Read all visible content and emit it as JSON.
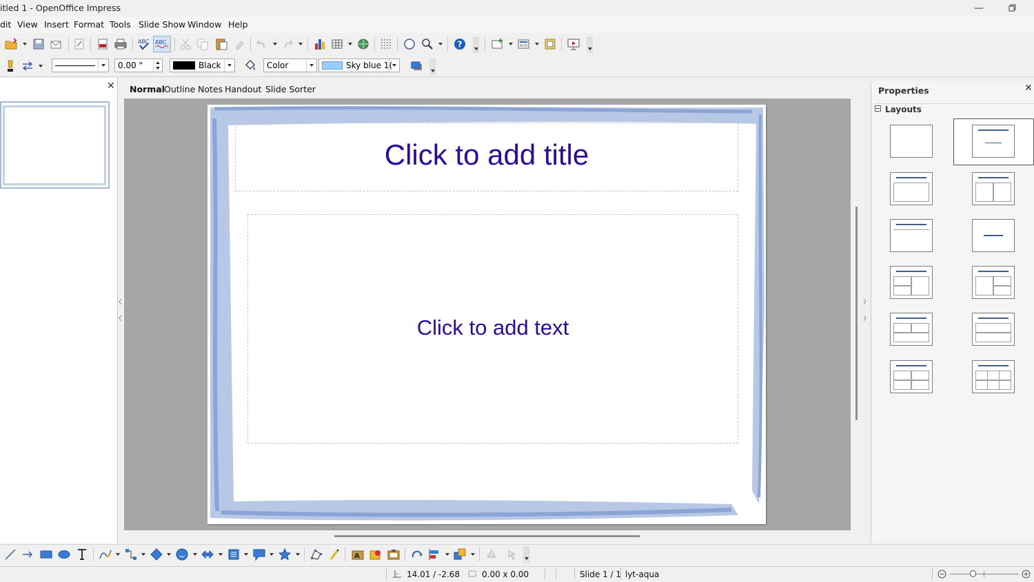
{
  "window": {
    "title": "itled 1 - OpenOffice Impress"
  },
  "menu": [
    "dit",
    "View",
    "Insert",
    "Format",
    "Tools",
    "Slide Show",
    "Window",
    "Help"
  ],
  "format_toolbar": {
    "line_width": "0.00 \"",
    "line_color": "Black",
    "area_style": "Color",
    "area_color": "Sky blue 1("
  },
  "view_tabs": [
    "Normal",
    "Outline",
    "Notes",
    "Handout",
    "Slide Sorter"
  ],
  "slide": {
    "title_placeholder": "Click to add title",
    "text_placeholder": "Click to add text"
  },
  "properties": {
    "title": "Properties",
    "section": "Layouts"
  },
  "status": {
    "position": "14.01 / -2.68",
    "size": "0.00 x 0.00",
    "slide": "Slide 1 / 1",
    "design": "lyt-aqua"
  },
  "colors": {
    "placeholder_text": "#2b0a9e",
    "frame_blue": "#8aa4d6",
    "line_color_swatch": "#000000",
    "area_color_swatch": "#99ccff"
  }
}
